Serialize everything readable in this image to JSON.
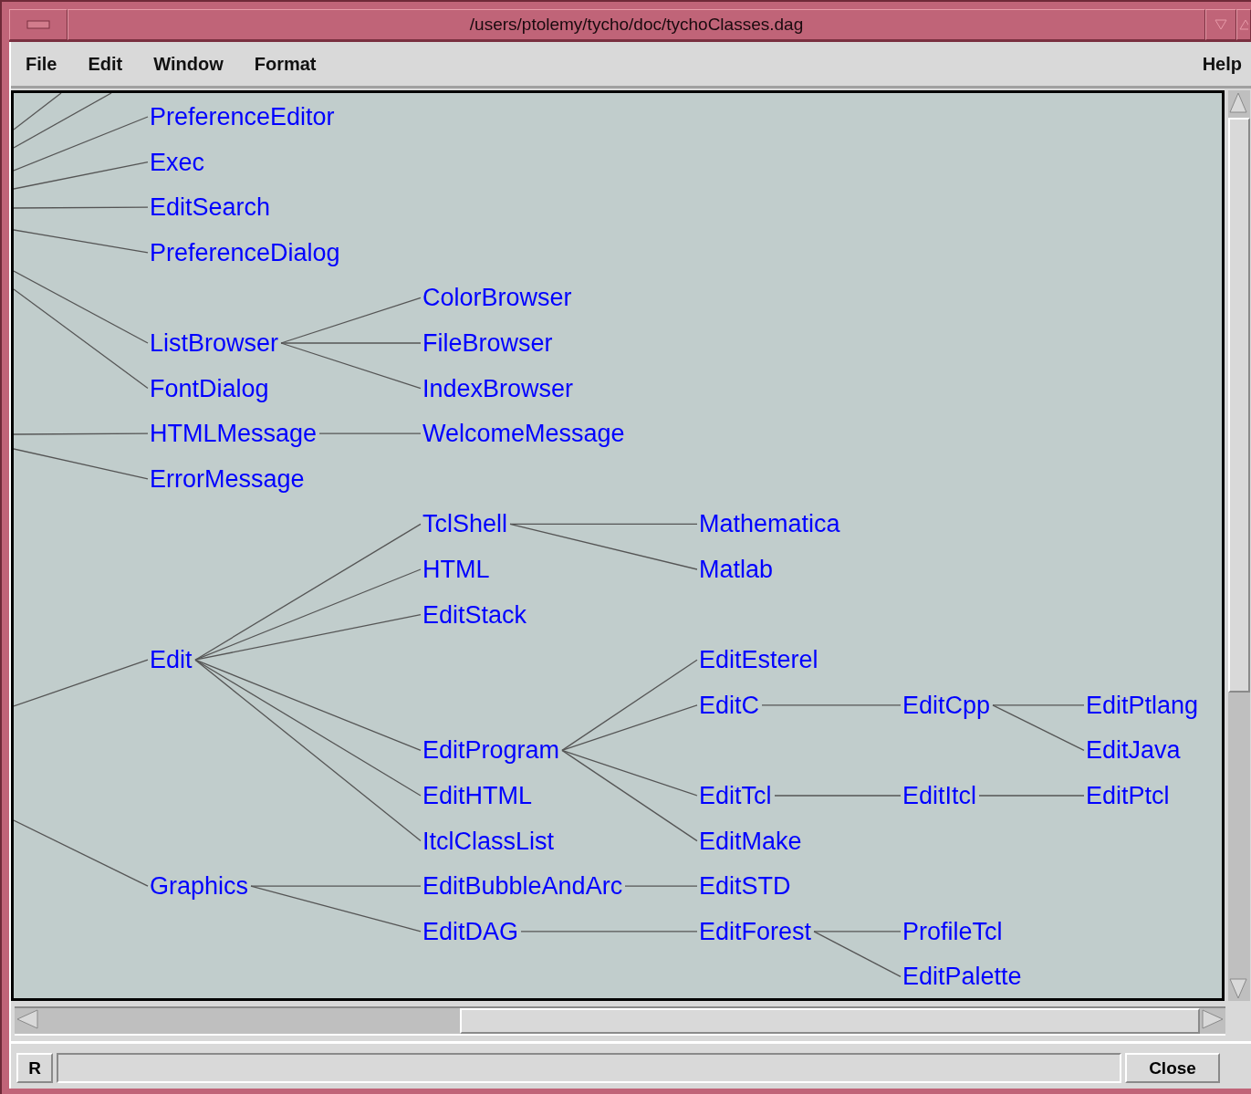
{
  "window": {
    "title": "/users/ptolemy/tycho/doc/tychoClasses.dag"
  },
  "menu": [
    {
      "label": "File"
    },
    {
      "label": "Edit"
    },
    {
      "label": "Window"
    },
    {
      "label": "Format"
    }
  ],
  "help_menu": {
    "label": "Help"
  },
  "graph": {
    "nodes": [
      {
        "label": "PreferenceEditor"
      },
      {
        "label": "Exec"
      },
      {
        "label": "EditSearch"
      },
      {
        "label": "PreferenceDialog"
      },
      {
        "label": "ListBrowser",
        "children": [
          {
            "label": "ColorBrowser"
          },
          {
            "label": "FileBrowser"
          },
          {
            "label": "IndexBrowser"
          }
        ]
      },
      {
        "label": "FontDialog"
      },
      {
        "label": "HTMLMessage",
        "children": [
          {
            "label": "WelcomeMessage"
          }
        ]
      },
      {
        "label": "ErrorMessage"
      },
      {
        "label": "Edit",
        "children": [
          {
            "label": "TclShell",
            "children": [
              {
                "label": "Mathematica"
              },
              {
                "label": "Matlab"
              }
            ]
          },
          {
            "label": "HTML"
          },
          {
            "label": "EditStack"
          },
          {
            "label": "EditProgram",
            "children": [
              {
                "label": "EditEsterel"
              },
              {
                "label": "EditC",
                "children": [
                  {
                    "label": "EditCpp",
                    "children": [
                      {
                        "label": "EditPtlang"
                      },
                      {
                        "label": "EditJava"
                      }
                    ]
                  }
                ]
              },
              {
                "label": "EditTcl",
                "children": [
                  {
                    "label": "EditItcl",
                    "children": [
                      {
                        "label": "EditPtcl"
                      }
                    ]
                  }
                ]
              },
              {
                "label": "EditMake"
              }
            ]
          },
          {
            "label": "EditHTML"
          },
          {
            "label": "ItclClassList"
          }
        ]
      },
      {
        "label": "Graphics",
        "children": [
          {
            "label": "EditBubbleAndArc",
            "children": [
              {
                "label": "EditSTD"
              }
            ]
          },
          {
            "label": "EditDAG",
            "children": [
              {
                "label": "EditForest",
                "children": [
                  {
                    "label": "ProfileTcl"
                  },
                  {
                    "label": "EditPalette"
                  }
                ]
              }
            ]
          }
        ]
      }
    ]
  },
  "bottom": {
    "r_button": "R",
    "close_button": "Close"
  }
}
